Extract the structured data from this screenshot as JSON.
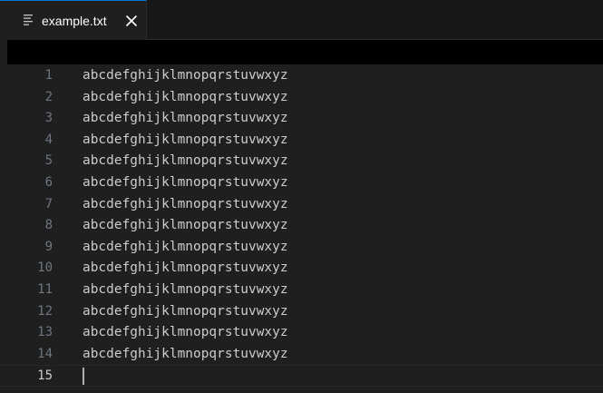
{
  "tab": {
    "label": "example.txt",
    "icon": "text-lines-icon",
    "close_icon": "close-icon",
    "accent": "#0078d4"
  },
  "editor": {
    "current_line": 15,
    "lines": [
      {
        "number": "1",
        "text": "abcdefghijklmnopqrstuvwxyz"
      },
      {
        "number": "2",
        "text": "abcdefghijklmnopqrstuvwxyz"
      },
      {
        "number": "3",
        "text": "abcdefghijklmnopqrstuvwxyz"
      },
      {
        "number": "4",
        "text": "abcdefghijklmnopqrstuvwxyz"
      },
      {
        "number": "5",
        "text": "abcdefghijklmnopqrstuvwxyz"
      },
      {
        "number": "6",
        "text": "abcdefghijklmnopqrstuvwxyz"
      },
      {
        "number": "7",
        "text": "abcdefghijklmnopqrstuvwxyz"
      },
      {
        "number": "8",
        "text": "abcdefghijklmnopqrstuvwxyz"
      },
      {
        "number": "9",
        "text": "abcdefghijklmnopqrstuvwxyz"
      },
      {
        "number": "10",
        "text": "abcdefghijklmnopqrstuvwxyz"
      },
      {
        "number": "11",
        "text": "abcdefghijklmnopqrstuvwxyz"
      },
      {
        "number": "12",
        "text": "abcdefghijklmnopqrstuvwxyz"
      },
      {
        "number": "13",
        "text": "abcdefghijklmnopqrstuvwxyz"
      },
      {
        "number": "14",
        "text": "abcdefghijklmnopqrstuvwxyz"
      },
      {
        "number": "15",
        "text": ""
      }
    ]
  }
}
